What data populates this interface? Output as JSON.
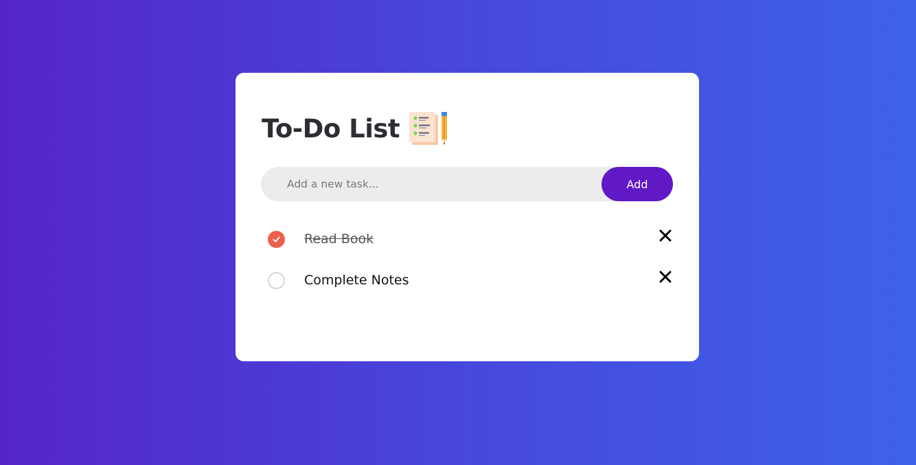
{
  "app": {
    "title": "To-Do List",
    "title_icon": "notepad-pencil-icon"
  },
  "input": {
    "placeholder": "Add a new task...",
    "value": "",
    "add_label": "Add"
  },
  "tasks": [
    {
      "text": "Read Book",
      "completed": true
    },
    {
      "text": "Complete Notes",
      "completed": false
    }
  ],
  "colors": {
    "background_start": "#5524c9",
    "background_end": "#3e62e8",
    "accent": "#6019c4",
    "done_check": "#ec5f4b"
  },
  "icons": {
    "check": "check-icon",
    "delete": "close-icon"
  }
}
